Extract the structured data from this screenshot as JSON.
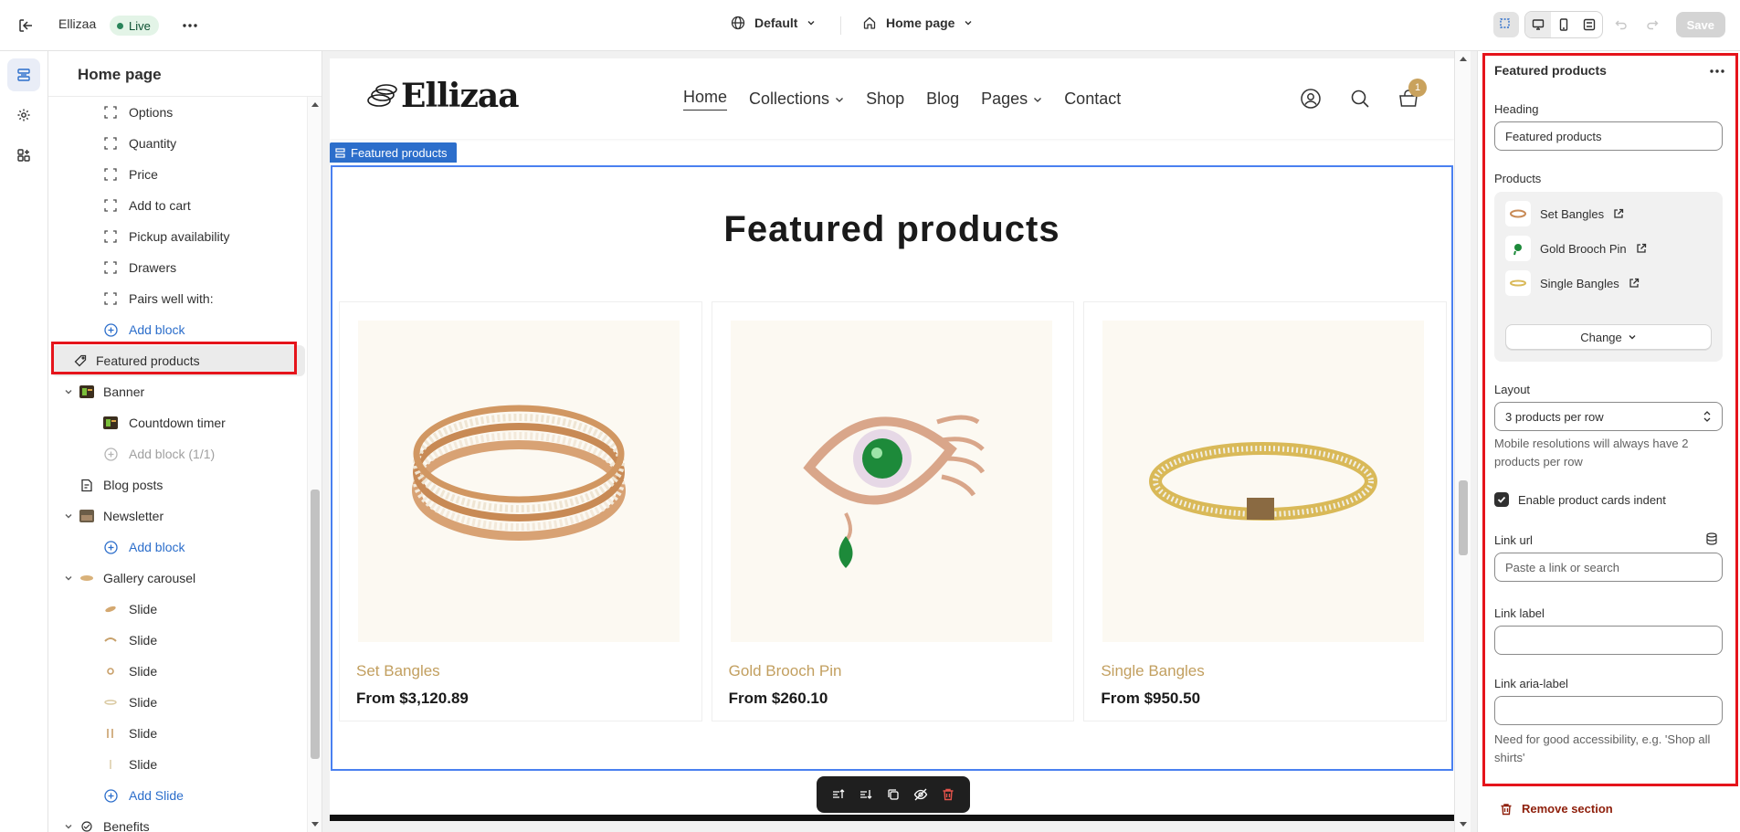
{
  "topbar": {
    "store_name": "Ellizaa",
    "status_badge": "Live",
    "theme": "Default",
    "page": "Home page",
    "save_label": "Save"
  },
  "sidebar": {
    "title": "Home page",
    "items": [
      {
        "label": "Options",
        "icon": "block-icon"
      },
      {
        "label": "Quantity",
        "icon": "block-icon"
      },
      {
        "label": "Price",
        "icon": "block-icon"
      },
      {
        "label": "Add to cart",
        "icon": "block-icon"
      },
      {
        "label": "Pickup availability",
        "icon": "block-icon"
      },
      {
        "label": "Drawers",
        "icon": "block-icon"
      },
      {
        "label": "Pairs well with:",
        "icon": "block-icon"
      },
      {
        "label": "Add block",
        "icon": "plus-circle-icon"
      },
      {
        "label": "Featured products",
        "icon": "tag-icon"
      },
      {
        "label": "Banner",
        "icon": "image-icon"
      },
      {
        "label": "Countdown timer",
        "icon": "image-icon"
      },
      {
        "label": "Add block (1/1)",
        "icon": "plus-circle-icon"
      },
      {
        "label": "Blog posts",
        "icon": "blog-icon"
      },
      {
        "label": "Newsletter",
        "icon": "image-icon"
      },
      {
        "label": "Add block",
        "icon": "plus-circle-icon"
      },
      {
        "label": "Gallery carousel",
        "icon": "image-icon"
      },
      {
        "label": "Slide",
        "icon": "image-icon"
      },
      {
        "label": "Slide",
        "icon": "image-icon"
      },
      {
        "label": "Slide",
        "icon": "image-icon"
      },
      {
        "label": "Slide",
        "icon": "image-icon"
      },
      {
        "label": "Slide",
        "icon": "image-icon"
      },
      {
        "label": "Slide",
        "icon": "image-icon"
      },
      {
        "label": "Add Slide",
        "icon": "plus-circle-icon"
      },
      {
        "label": "Benefits",
        "icon": "image-icon"
      }
    ]
  },
  "preview": {
    "logo": "Ellizaa",
    "nav": [
      "Home",
      "Collections",
      "Shop",
      "Blog",
      "Pages",
      "Contact"
    ],
    "cart_count": "1",
    "section_tag": "Featured products",
    "heading": "Featured products",
    "products": [
      {
        "name": "Set Bangles",
        "price": "From $3,120.89"
      },
      {
        "name": "Gold Brooch Pin",
        "price": "From $260.10"
      },
      {
        "name": "Single Bangles",
        "price": "From $950.50"
      }
    ]
  },
  "panel": {
    "title": "Featured products",
    "heading_label": "Heading",
    "heading_value": "Featured products",
    "products_label": "Products",
    "products": [
      "Set Bangles",
      "Gold Brooch Pin",
      "Single Bangles"
    ],
    "change_label": "Change",
    "layout_label": "Layout",
    "layout_value": "3 products per row",
    "layout_hint": "Mobile resolutions will always have 2 products per row",
    "indent_label": "Enable product cards indent",
    "link_url_label": "Link url",
    "link_url_placeholder": "Paste a link or search",
    "link_label_label": "Link label",
    "link_aria_label": "Link aria-label",
    "aria_hint": "Need for good accessibility, e.g. 'Shop all shirts'",
    "remove_label": "Remove section"
  },
  "colors": {
    "accent": "#2c6ecb",
    "highlight": "#e5141b",
    "product_name": "#c29f5f",
    "live": "#29845a"
  }
}
